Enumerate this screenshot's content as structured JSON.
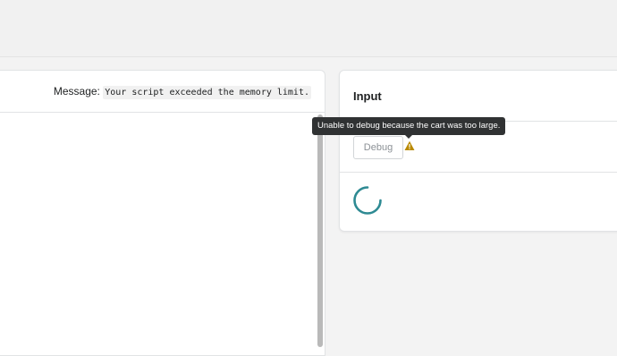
{
  "left_panel": {
    "message_label": "Message:",
    "message_value": "Your script exceeded the memory limit."
  },
  "right_panel": {
    "title": "Input",
    "debug_button_label": "Debug",
    "tooltip_text": "Unable to debug because the cart was too large.",
    "warning_icon": "warning-icon",
    "loading_icon": "spinner-icon"
  },
  "colors": {
    "accent_teal": "#2e8a93",
    "warning": "#b98900",
    "tooltip_bg": "#303233"
  }
}
